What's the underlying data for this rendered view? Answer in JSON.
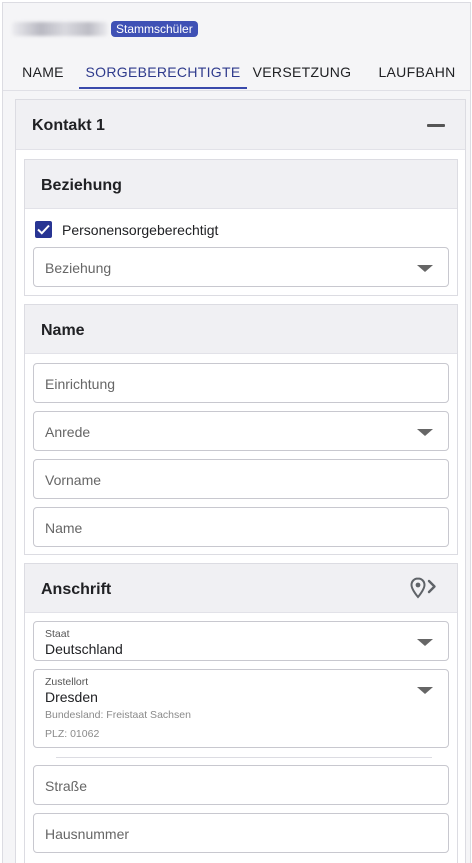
{
  "header": {
    "badge": "Stammschüler"
  },
  "tabs": [
    {
      "label": "NAME"
    },
    {
      "label": "SORGEBERECHTIGTE"
    },
    {
      "label": "VERSETZUNG"
    },
    {
      "label": "LAUFBAHN"
    }
  ],
  "active_tab": "SORGEBERECHTIGTE",
  "contact": {
    "title": "Kontakt 1",
    "beziehung": {
      "title": "Beziehung",
      "checkbox_label": "Personensorgeberechtigt",
      "checked": true,
      "select_placeholder": "Beziehung"
    },
    "name": {
      "title": "Name",
      "einrichtung_placeholder": "Einrichtung",
      "anrede_placeholder": "Anrede",
      "vorname_placeholder": "Vorname",
      "name_placeholder": "Name"
    },
    "anschrift": {
      "title": "Anschrift",
      "staat_label": "Staat",
      "staat_value": "Deutschland",
      "zustellort_label": "Zustellort",
      "zustellort_value": "Dresden",
      "bundesland": "Bundesland: Freistaat Sachsen",
      "plz": "PLZ: 01062",
      "strasse_placeholder": "Straße",
      "hausnummer_placeholder": "Hausnummer"
    }
  },
  "colors": {
    "accent": "#3f51b5",
    "active_tab_text": "#2e3a8c"
  }
}
